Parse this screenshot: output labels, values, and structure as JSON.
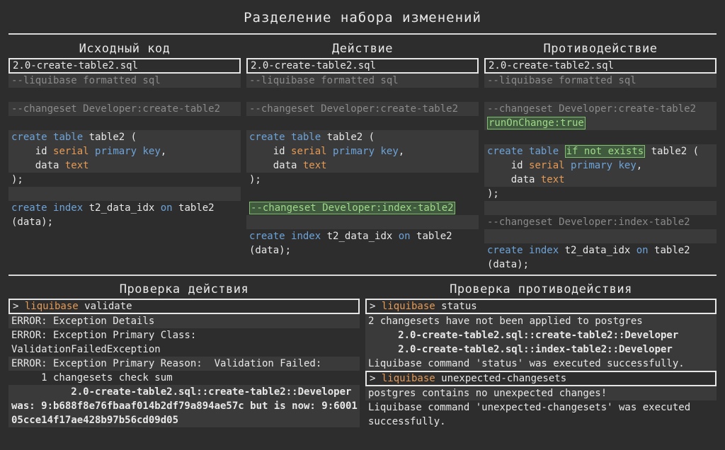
{
  "title": "Разделение набора изменений",
  "columns": {
    "source": {
      "heading": "Исходный код",
      "file": "2.0-create-table2.sql"
    },
    "action": {
      "heading": "Действие",
      "file": "2.0-create-table2.sql"
    },
    "counter": {
      "heading": "Противодействие",
      "file": "2.0-create-table2.sql"
    }
  },
  "code": {
    "formatted": "--liquibase formatted sql",
    "cs_create": "--changeset Developer:create-table2",
    "cs_index": "--changeset Developer:index-table2",
    "run_on_change": "runOnChange:true",
    "create": "create",
    "table": "table",
    "table2_open": " table2 (",
    "if_not_exists": "if not exists",
    "table2_open_after": " table2 (",
    "id_pre": "    id ",
    "serial": "serial",
    "primary_key": "primary key",
    "comma": ",",
    "data_pre": "    data ",
    "text": "text",
    "close": ");",
    "index": "index",
    "idx_name": " t2_data_idx ",
    "on": "on",
    "idx_tail": " table2",
    "idx_cols": "(data);"
  },
  "validate": {
    "heading": "Проверка действия",
    "prompt": "> ",
    "liquibase": "liquibase",
    "command": " validate",
    "l1": "ERROR: Exception Details",
    "l2": "ERROR: Exception Primary Class:",
    "l3": "ValidationFailedException",
    "l4": "ERROR: Exception Primary Reason:  Validation Failed:",
    "l5": "     1 changesets check sum",
    "l6": "          2.0-create-table2.sql::create-table2::Developer was: 9:b688f8e76fbaaf014b2df79a894ae57c but is now: 9:600105cce14f17ae428b97b56cd09d05"
  },
  "status": {
    "heading": "Проверка противодействия",
    "prompt": "> ",
    "liquibase": "liquibase",
    "command": " status",
    "l1": "2 changesets have not been applied to postgres",
    "l2": "     2.0-create-table2.sql::create-table2::Developer",
    "l3": "     2.0-create-table2.sql::index-table2::Developer",
    "l4": "Liquibase command 'status' was executed successfully.",
    "command2": " unexpected-changesets",
    "l5": "postgres contains no unexpected changes!",
    "l6": "Liquibase command 'unexpected-changesets' was executed successfully."
  }
}
